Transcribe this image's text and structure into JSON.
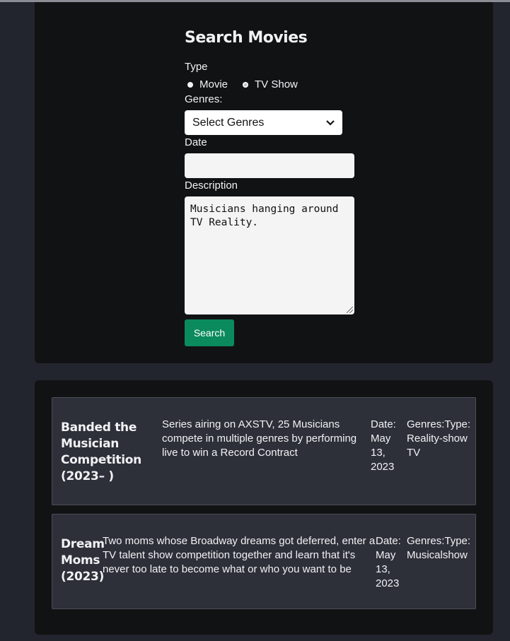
{
  "search": {
    "title": "Search Movies",
    "type_label": "Type",
    "type_options": [
      "Movie",
      "TV Show"
    ],
    "type_selected": "TV Show",
    "genres_label": "Genres:",
    "genres_value": "Select Genres",
    "date_label": "Date",
    "date_value": "",
    "description_label": "Description",
    "description_value": "Musicians hanging around\nTV Reality.",
    "button_label": "Search"
  },
  "results": [
    {
      "title": "Banded the Musician Competition (2023– )",
      "description": "Series airing on AXSTV, 25 Musicians compete in multiple genres by performing live to win a Record Contract",
      "date": "Date: May 13, 2023",
      "genres_type": "Genres:Type: Reality-show TV"
    },
    {
      "title": "Dream Moms (2023)",
      "description": "Two moms whose Broadway dreams got deferred, enter a TV talent show competition together and learn that it's never too late to become what or who you want to be",
      "date": "Date: May 13, 2023",
      "genres_type": "Genres:Type: Musicalshow"
    }
  ],
  "colors": {
    "background": "#22252d",
    "panel": "#111214",
    "card": "#2d3039",
    "accent": "#0b8a5e"
  }
}
